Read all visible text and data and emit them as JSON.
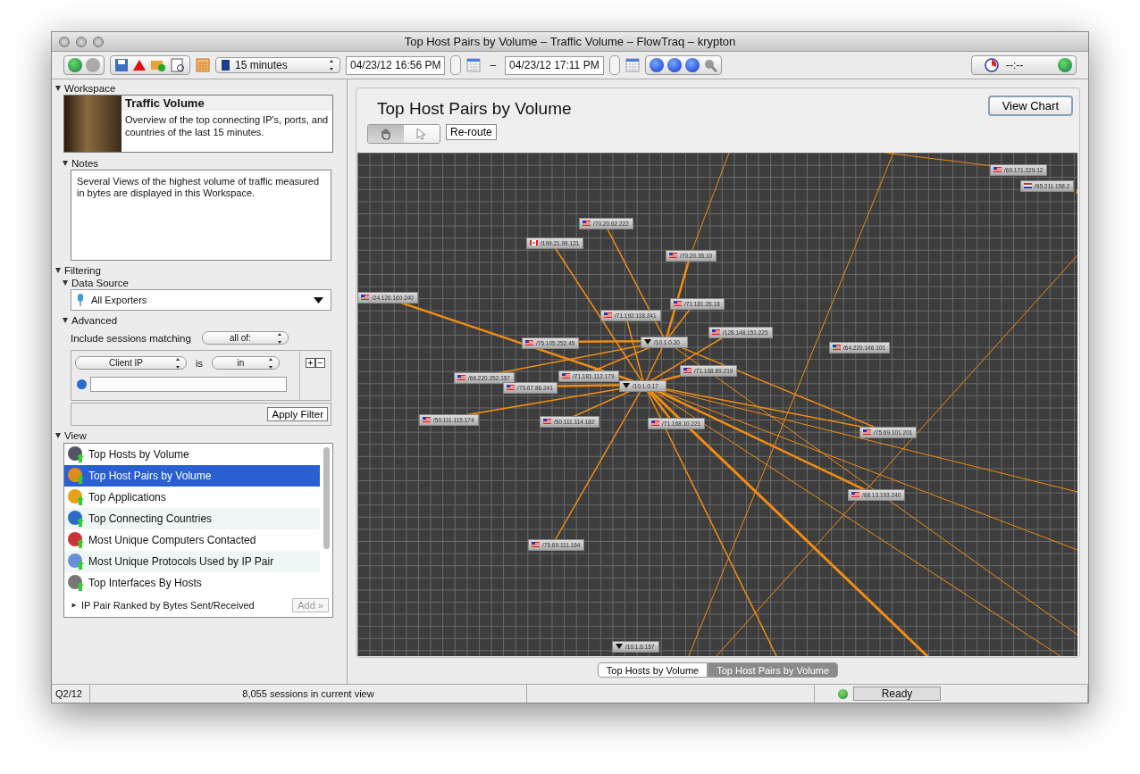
{
  "window": {
    "title": "Top Host Pairs by Volume – Traffic Volume – FlowTraq – krypton"
  },
  "toolbar": {
    "range": "15 minutes",
    "start": "04/23/12 16:56 PM",
    "separator": "–",
    "end": "04/23/12 17:11 PM",
    "clock": "--:--"
  },
  "workspace": {
    "heading": "Workspace",
    "expanded": true,
    "title": "Traffic Volume",
    "description": "Overview of the top connecting IP's, ports, and countries of the last 15 minutes."
  },
  "notes": {
    "heading": "Notes",
    "expanded": true,
    "text": "Several Views of the highest volume of traffic measured in bytes are displayed in this Workspace."
  },
  "filtering": {
    "heading": "Filtering",
    "expanded": true,
    "data_source_heading": "Data Source",
    "data_source": "All Exporters",
    "advanced_heading": "Advanced",
    "match_label": "Include sessions matching",
    "match_mode": "all of:",
    "field": "Client IP",
    "operator_label": "is",
    "operator": "in",
    "add": "+",
    "remove": "−",
    "apply": "Apply Filter"
  },
  "view": {
    "heading": "View",
    "expanded": true,
    "items": [
      {
        "label": "Top Hosts by Volume",
        "selected": false
      },
      {
        "label": "Top Host Pairs by Volume",
        "selected": true
      },
      {
        "label": "Top Applications",
        "selected": false
      },
      {
        "label": "Top Connecting Countries",
        "selected": false
      },
      {
        "label": "Most Unique Computers Contacted",
        "selected": false
      },
      {
        "label": "Most Unique Protocols Used by IP Pair",
        "selected": false
      },
      {
        "label": "Top Interfaces By Hosts",
        "selected": false
      }
    ],
    "more": {
      "label": "IP Pair Ranked by Bytes Sent/Received",
      "expanded": false
    },
    "add": {
      "label": "Add »",
      "disabled": true
    }
  },
  "main": {
    "title": "Top Host Pairs by Volume",
    "view_chart": "View Chart",
    "tools": [
      {
        "kind": "hand",
        "selected": true
      },
      {
        "kind": "pointer",
        "selected": false
      }
    ],
    "reroute": "Re-route",
    "nodes": [
      {
        "label": "/70.20.62.222",
        "kind": "us"
      },
      {
        "label": "/199.21.99.121",
        "kind": "ca"
      },
      {
        "label": "/70.20.35.10",
        "kind": "us"
      },
      {
        "label": "/24.126.160.240",
        "kind": "us"
      },
      {
        "label": "/71.181.26.18",
        "kind": "us"
      },
      {
        "label": "/71.192.118.241",
        "kind": "us"
      },
      {
        "label": "/128.148.151.225",
        "kind": "us"
      },
      {
        "label": "/75.105.252.45",
        "kind": "us"
      },
      {
        "label": "/10.1.0.20",
        "kind": "local"
      },
      {
        "label": "/64.220.146.101",
        "kind": "us"
      },
      {
        "label": "/71.168.89.219",
        "kind": "us"
      },
      {
        "label": "/66.220.252.157",
        "kind": "us"
      },
      {
        "label": "/71.181.112.179",
        "kind": "us"
      },
      {
        "label": "/75.67.86.241",
        "kind": "us"
      },
      {
        "label": "/10.1.0.17",
        "kind": "local"
      },
      {
        "label": "/50.111.115.174",
        "kind": "us"
      },
      {
        "label": "/50.111.114.182",
        "kind": "us"
      },
      {
        "label": "/71.168.10.221",
        "kind": "us"
      },
      {
        "label": "/75.69.101.201",
        "kind": "us"
      },
      {
        "label": "/68.13.193.240",
        "kind": "us"
      },
      {
        "label": "/75.69.111.164",
        "kind": "us"
      },
      {
        "label": "/10.1.6.157",
        "kind": "local"
      },
      {
        "label": "/69.171.229.12",
        "kind": "us"
      },
      {
        "label": "/95.211.158.2",
        "kind": "nl"
      }
    ],
    "tabs": [
      {
        "label": "Top Hosts by Volume",
        "selected": false
      },
      {
        "label": "Top Host Pairs by Volume",
        "selected": true
      }
    ]
  },
  "status_bar": {
    "period": "Q2/12",
    "sessions": "8,055 sessions in current view",
    "status": "Ready"
  }
}
